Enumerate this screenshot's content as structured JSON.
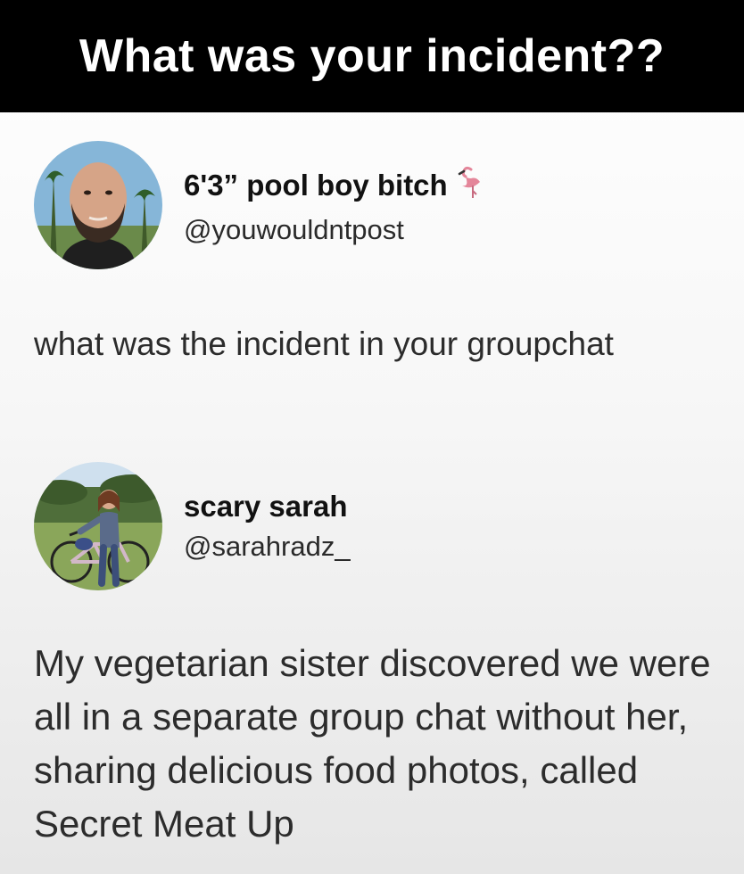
{
  "banner": {
    "title": "What was your incident??"
  },
  "tweet1": {
    "display_name": "6'3” pool boy bitch",
    "name_emoji": "flamingo-icon",
    "handle": "@youwouldntpost",
    "text": "what was the incident in your groupchat"
  },
  "tweet2": {
    "display_name": "scary sarah",
    "handle": "@sarahradz_",
    "text": "My vegetarian sister discovered we were all in a separate group chat without her, sharing delicious food photos, called Secret Meat Up"
  },
  "colors": {
    "banner_bg": "#000000",
    "banner_text": "#ffffff",
    "text": "#2c2c2c"
  }
}
